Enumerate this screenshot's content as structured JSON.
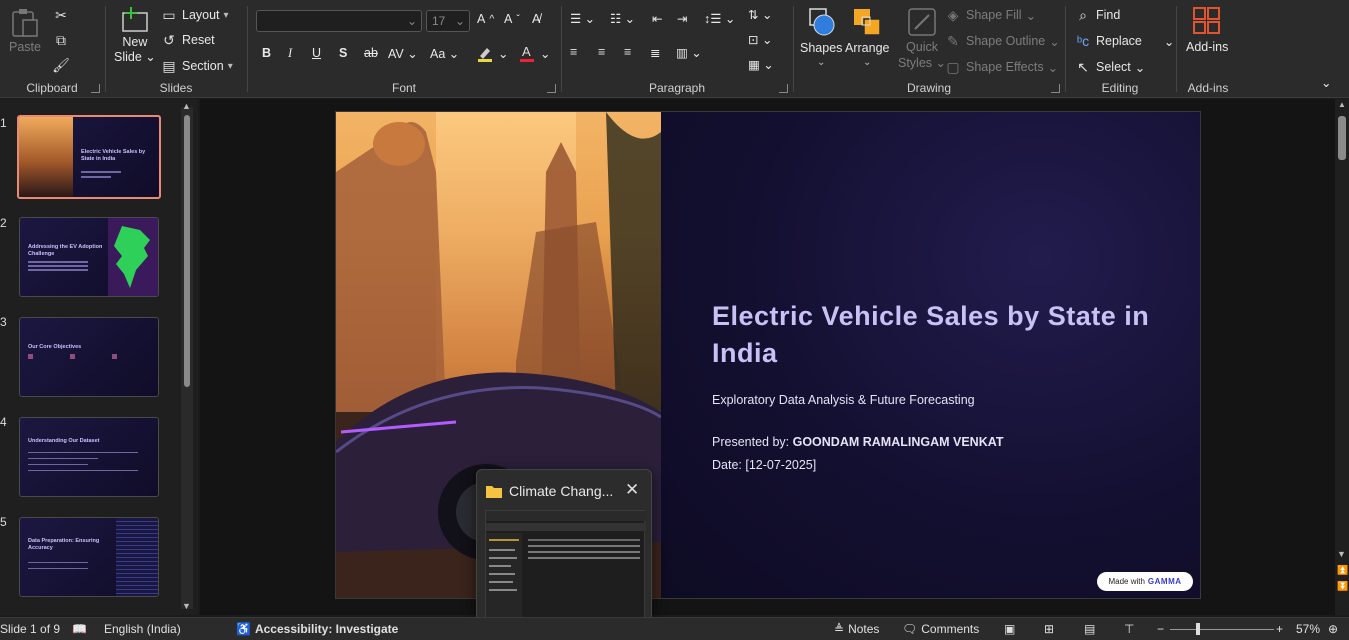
{
  "ribbon": {
    "clipboard": {
      "label": "Clipboard",
      "paste": "Paste"
    },
    "slides": {
      "label": "Slides",
      "new_slide": "New",
      "new_slide_2": "Slide",
      "layout": "Layout",
      "reset": "Reset",
      "section": "Section"
    },
    "font": {
      "label": "Font",
      "font_size": "17"
    },
    "paragraph": {
      "label": "Paragraph"
    },
    "drawing": {
      "label": "Drawing",
      "shapes": "Shapes",
      "arrange": "Arrange",
      "quick_styles": "Quick",
      "quick_styles_2": "Styles",
      "shape_fill": "Shape Fill",
      "shape_outline": "Shape Outline",
      "shape_effects": "Shape Effects"
    },
    "editing": {
      "label": "Editing",
      "find": "Find",
      "replace": "Replace",
      "select": "Select"
    },
    "addins": {
      "label": "Add-ins",
      "addins_btn": "Add-ins"
    }
  },
  "thumbnails": [
    {
      "num": "1",
      "title": "Electric Vehicle Sales by State in India"
    },
    {
      "num": "2",
      "title": "Addressing the EV Adoption Challenge"
    },
    {
      "num": "3",
      "title": "Our Core Objectives"
    },
    {
      "num": "4",
      "title": "Understanding Our Dataset"
    },
    {
      "num": "5",
      "title": "Data Preparation: Ensuring Accuracy"
    }
  ],
  "slide": {
    "title": "Electric Vehicle Sales by State in India",
    "subtitle": "Exploratory Data Analysis & Future Forecasting",
    "presented_label": "Presented by: ",
    "presenter": "GOONDAM RAMALINGAM VENKAT",
    "date": "Date: [12-07-2025]",
    "badge_prefix": "Made with",
    "badge_brand": "GAMMA"
  },
  "popup": {
    "title": "Climate Chang..."
  },
  "status": {
    "slide_info": "Slide 1 of 9",
    "language": "English (India)",
    "accessibility": "Accessibility: Investigate",
    "notes": "Notes",
    "comments": "Comments",
    "zoom": "57%"
  },
  "colors": {
    "accent": "#e98a76",
    "title": "#c9c1f5",
    "slide_bg": "#120f2c"
  }
}
